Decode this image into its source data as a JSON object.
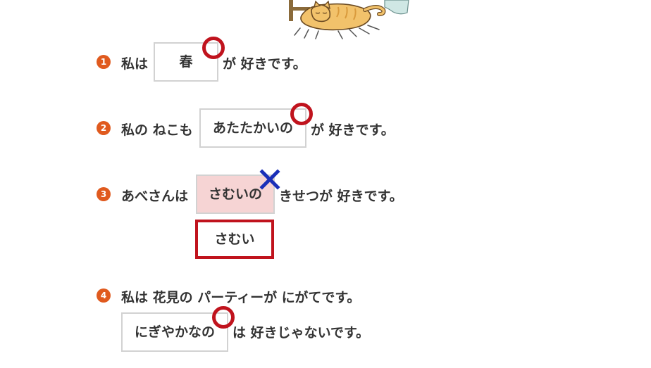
{
  "exercise": {
    "items": [
      {
        "number": "1",
        "before": "私は",
        "answer": "春",
        "after": "が 好きです。",
        "result": "correct"
      },
      {
        "number": "2",
        "before": "私の ねこも",
        "answer": "あたたかいの",
        "after": "が 好きです。",
        "result": "correct"
      },
      {
        "number": "3",
        "before": "あべさんは",
        "answer": "さむいの",
        "after": "きせつが 好きです。",
        "result": "incorrect",
        "correction": "さむい"
      },
      {
        "number": "4",
        "before": "私は 花見の パーティーが にがてです。",
        "answer": "にぎやかなの",
        "after": "は 好きじゃないです。",
        "result": "correct"
      }
    ]
  },
  "marks": {
    "correct_color": "#c0131d",
    "incorrect_color": "#1a2fb8",
    "correct_icon": "circle-mark-icon",
    "incorrect_icon": "cross-mark-icon",
    "number_badge_color": "#e05a1e",
    "wrong_answer_bg": "#f6d4d4"
  }
}
